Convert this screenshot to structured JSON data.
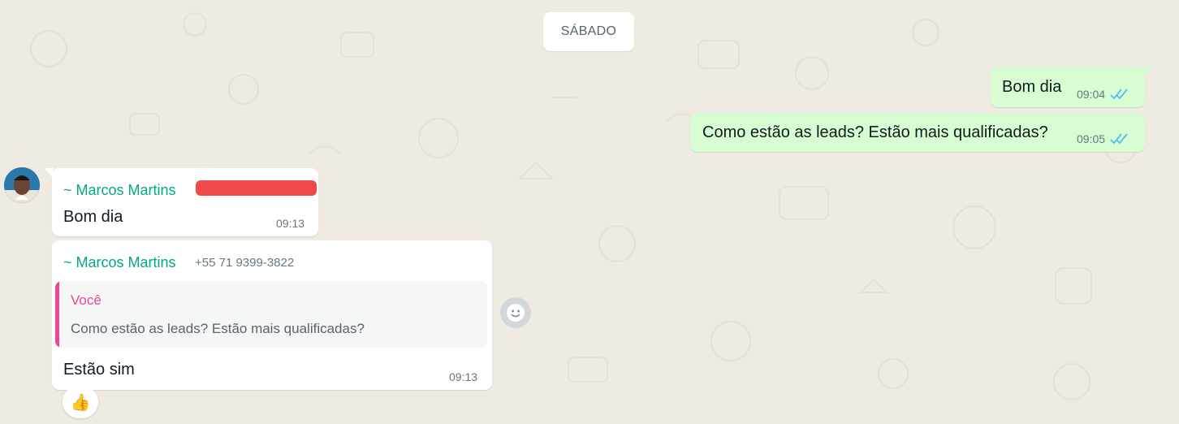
{
  "date_separator": "SÁBADO",
  "colors": {
    "background": "#efeae2",
    "outgoing_bubble": "#d9fdd3",
    "incoming_bubble": "#ffffff",
    "sender_name": "#00a884",
    "quote_accent": "#e8479a",
    "read_ticks": "#53bdeb",
    "redaction": "#f03a3a"
  },
  "outgoing_messages": [
    {
      "text": "Bom dia",
      "time": "09:04",
      "status": "read"
    },
    {
      "text": "Como estão as leads? Estão mais qualificadas?",
      "time": "09:05",
      "status": "read"
    }
  ],
  "incoming_messages": [
    {
      "sender": "~ Marcos Martins",
      "phone_redacted": true,
      "text": "Bom dia",
      "time": "09:13"
    },
    {
      "sender": "~ Marcos Martins",
      "phone": "+55 71 9399-3822",
      "quote": {
        "author": "Você",
        "text": "Como estão as leads? Estão mais qualificadas?"
      },
      "text": "Estão sim",
      "time": "09:13",
      "reaction": "👍"
    }
  ],
  "icons": {
    "avatar": "contact-avatar",
    "emoji_reaction_button": "smiley-icon",
    "read_receipt": "double-check-icon"
  }
}
